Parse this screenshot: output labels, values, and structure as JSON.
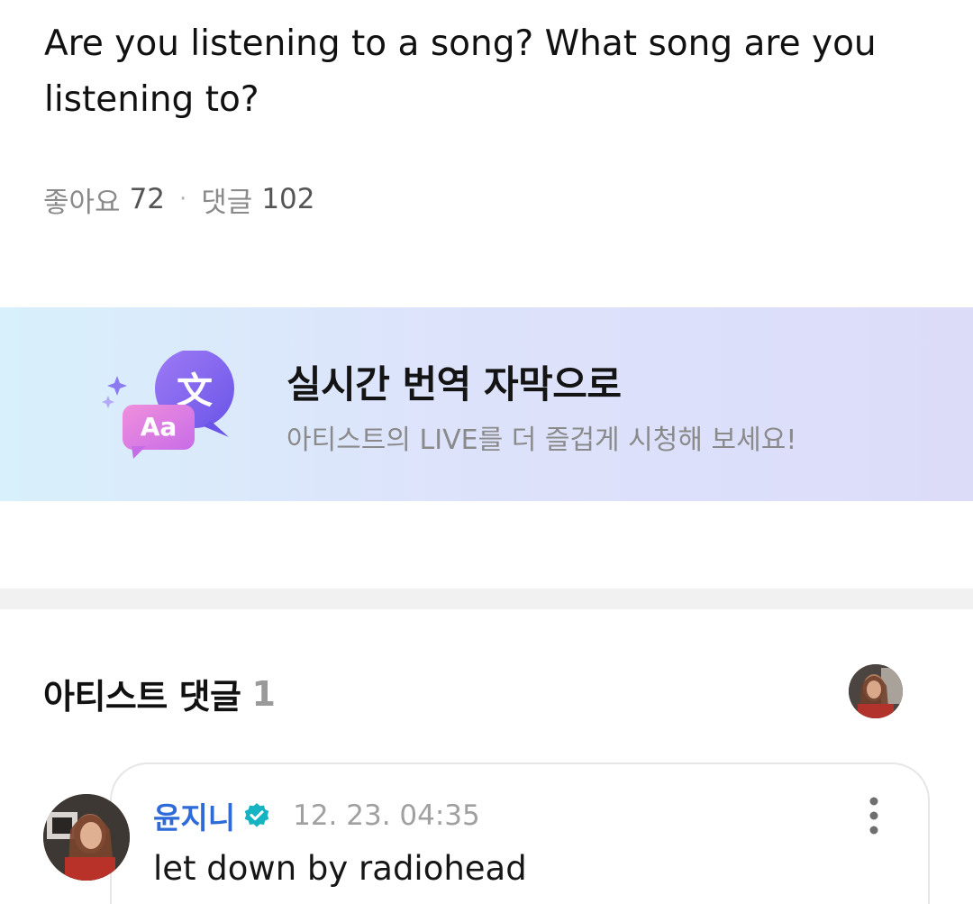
{
  "post": {
    "text": "Are you listening to a song? What song are you listening to?",
    "likes_label": "좋아요",
    "likes_count": "72",
    "separator": "·",
    "comments_label": "댓글",
    "comments_count": "102"
  },
  "banner": {
    "icon_glyph_top": "文",
    "icon_glyph_bottom": "Aa",
    "title": "실시간 번역 자막으로",
    "subtitle": "아티스트의 LIVE를 더 즐겁게 시청해 보세요!"
  },
  "artist_comments": {
    "title": "아티스트 댓글",
    "count": "1"
  },
  "comment": {
    "author": "윤지니",
    "timestamp": "12. 23. 04:35",
    "text": "let down by radiohead"
  },
  "colors": {
    "author_blue": "#2f6bd8",
    "verified_teal": "#16b3c2",
    "banner_start": "#d8f0fb",
    "banner_end": "#dcdcf9"
  },
  "icons": [
    "translate-icon",
    "sparkle-icon",
    "verified-icon",
    "more-vertical-icon"
  ]
}
